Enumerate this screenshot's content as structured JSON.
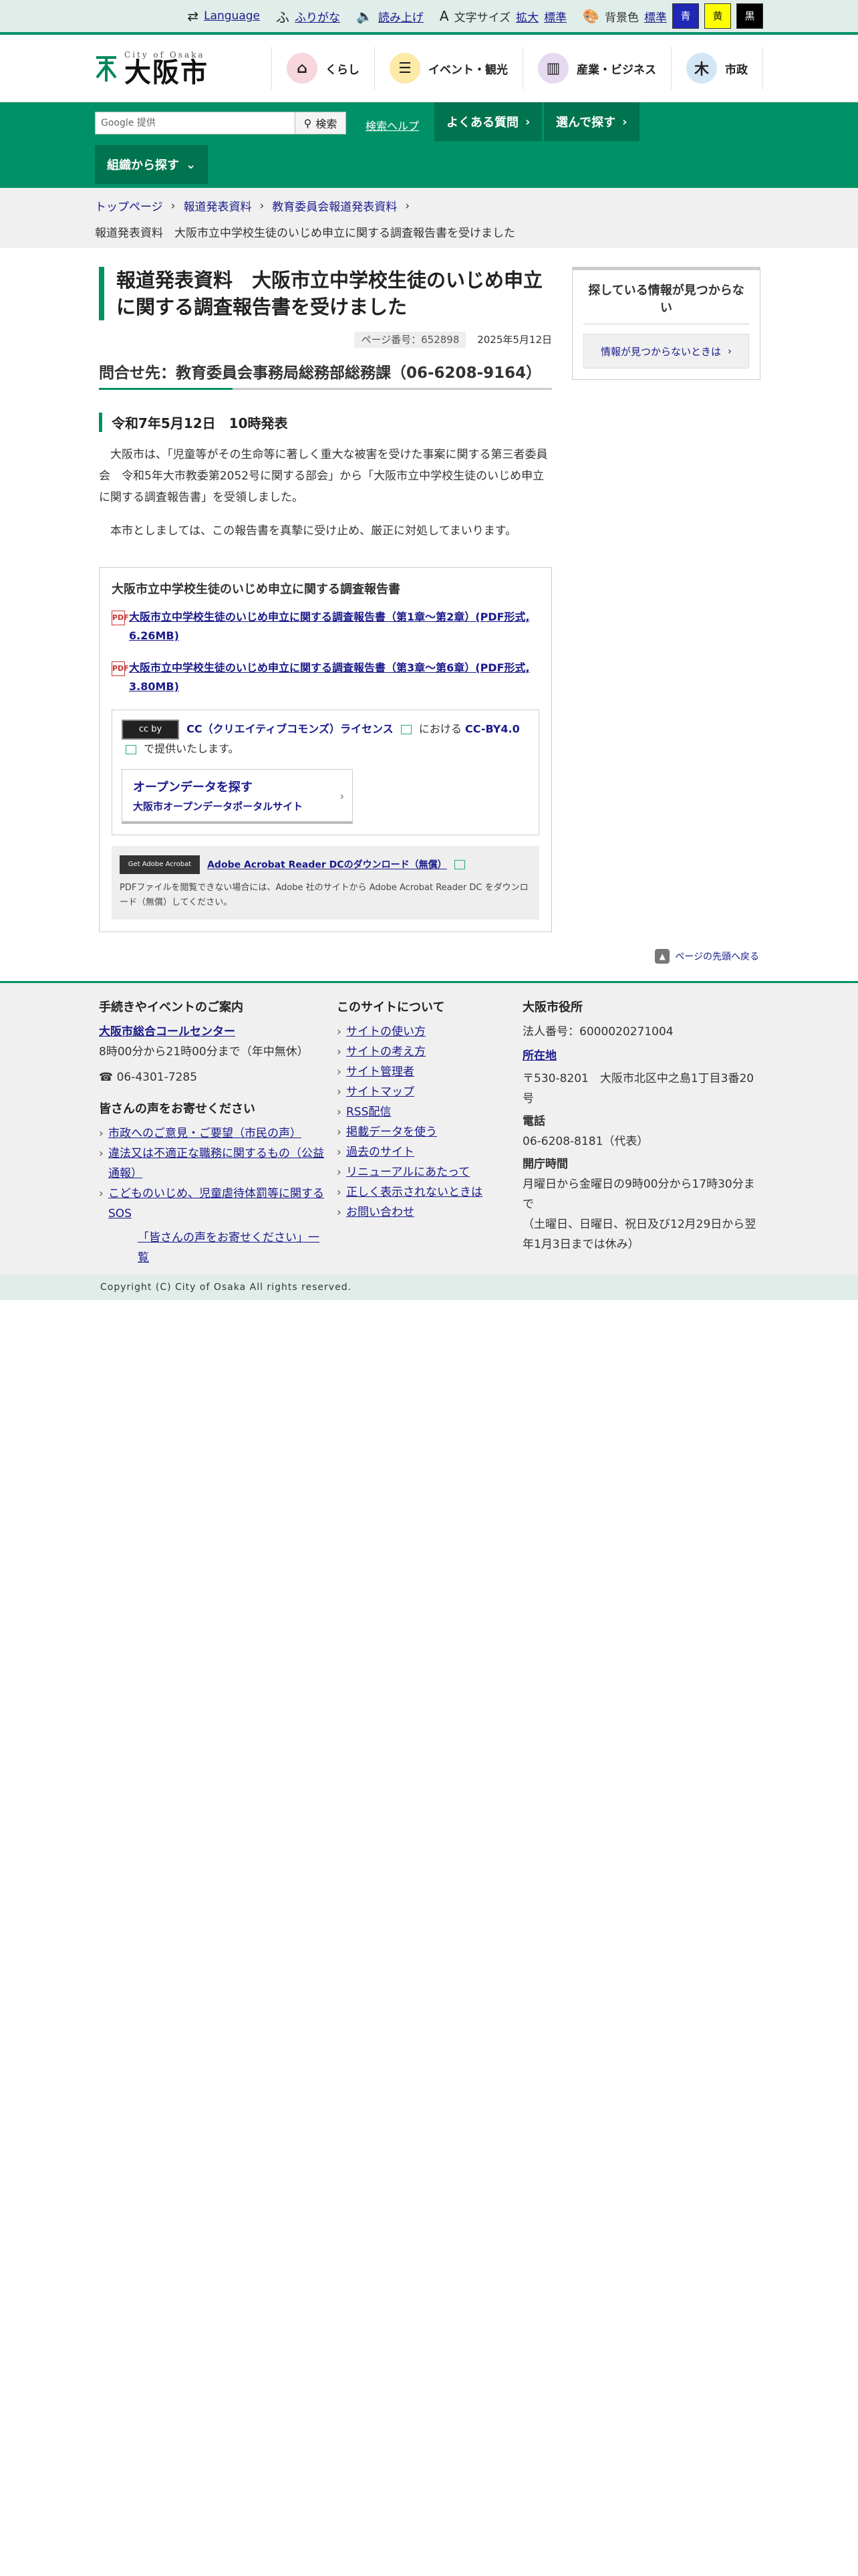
{
  "utility": {
    "language": "Language",
    "furigana": "ふりがな",
    "read_aloud": "読み上げ",
    "font_size_label": "文字サイズ",
    "font_enlarge": "拡大",
    "font_standard": "標準",
    "bg_color_label": "背景色",
    "bg_standard": "標準",
    "bg_blue": "青",
    "bg_yellow": "黄",
    "bg_black": "黒"
  },
  "header": {
    "logo_sub": "City of Osaka",
    "logo_main": "大阪市",
    "nav": [
      {
        "label": "くらし",
        "icon": "house-icon",
        "color": "#f7d6dc"
      },
      {
        "label": "イベント・観光",
        "icon": "event-icon",
        "color": "#fde9a8"
      },
      {
        "label": "産業・ビジネス",
        "icon": "building-icon",
        "color": "#e5daf0"
      },
      {
        "label": "市政",
        "icon": "city-mark-icon",
        "color": "#d3e6f3"
      }
    ]
  },
  "greennav": {
    "search_placeholder": "Google 提供",
    "search_button": "検索",
    "search_help": "検索ヘルプ",
    "faq": "よくある質問",
    "choose": "選んで探す",
    "org": "組織から探す"
  },
  "breadcrumb": {
    "items": [
      "トップページ",
      "報道発表資料",
      "教育委員会報道発表資料"
    ],
    "current": "報道発表資料　大阪市立中学校生徒のいじめ申立に関する調査報告書を受けました"
  },
  "article": {
    "title": "報道発表資料　大阪市立中学校生徒のいじめ申立に関する調査報告書を受けました",
    "page_number": "ページ番号：652898",
    "date": "2025年5月12日",
    "contact": "問合せ先：教育委員会事務局総務部総務課（06-6208-9164）",
    "date_heading": "令和7年5月12日　10時発表",
    "para1": "大阪市は、「児童等がその生命等に著しく重大な被害を受けた事案に関する第三者委員会　令和5年大市教委第2052号に関する部会」から「大阪市立中学校生徒のいじめ申立に関する調査報告書」を受領しました。",
    "para2": "本市としましては、この報告書を真摯に受け止め、厳正に対処してまいります。",
    "box_title": "大阪市立中学校生徒のいじめ申立に関する調査報告書",
    "pdf1": "大阪市立中学校生徒のいじめ申立に関する調査報告書（第1章～第2章）(PDF形式, 6.26MB)",
    "pdf2": "大阪市立中学校生徒のいじめ申立に関する調査報告書（第3章～第6章）(PDF形式, 3.80MB)",
    "cc_badge": "cc by",
    "cc_link": "CC（クリエイティブコモンズ）ライセンス",
    "cc_mid": "における",
    "cc_version": "CC-BY4.0",
    "cc_tail": "で提供いたします。",
    "od_title": "オープンデータを探す",
    "od_sub": "大阪市オープンデータポータルサイト",
    "adobe_badge": "Get Adobe Acrobat Reader",
    "adobe_link": "Adobe Acrobat Reader DCのダウンロード（無償）",
    "adobe_note": "PDFファイルを閲覧できない場合には、Adobe 社のサイトから Adobe Acrobat Reader DC をダウンロード（無償）してください。"
  },
  "sidebar": {
    "title": "探している情報が見つからない",
    "button": "情報が見つからないときは"
  },
  "pagetop": "ページの先頭へ戻る",
  "footer": {
    "col1": {
      "title": "手続きやイベントのご案内",
      "call_center": "大阪市総合コールセンター",
      "hours": "8時00分から21時00分まで（年中無休）",
      "phone": "06-4301-7285",
      "voice_title": "皆さんの声をお寄せください",
      "voice_links": [
        "市政へのご意見・ご要望（市民の声）",
        "違法又は不適正な職務に関するもの（公益通報）",
        "こどものいじめ、児童虐待体罰等に関するSOS"
      ],
      "voice_all": "「皆さんの声をお寄せください」一覧"
    },
    "col2": {
      "title": "このサイトについて",
      "links": [
        "サイトの使い方",
        "サイトの考え方",
        "サイト管理者",
        "サイトマップ",
        "RSS配信",
        "掲載データを使う",
        "過去のサイト",
        "リニューアルにあたって",
        "正しく表示されないときは",
        "お問い合わせ"
      ]
    },
    "col3": {
      "title": "大阪市役所",
      "corp_no": "法人番号：6000020271004",
      "location_link": "所在地",
      "address": "〒530-8201　大阪市北区中之島1丁目3番20号",
      "phone_label": "電話",
      "phone": "06-6208-8181（代表）",
      "hours_label": "開庁時間",
      "hours": "月曜日から金曜日の9時00分から17時30分まで",
      "holiday": "（土曜日、日曜日、祝日及び12月29日から翌年1月3日までは休み）"
    },
    "copyright": "Copyright (C) City of Osaka All rights reserved."
  }
}
